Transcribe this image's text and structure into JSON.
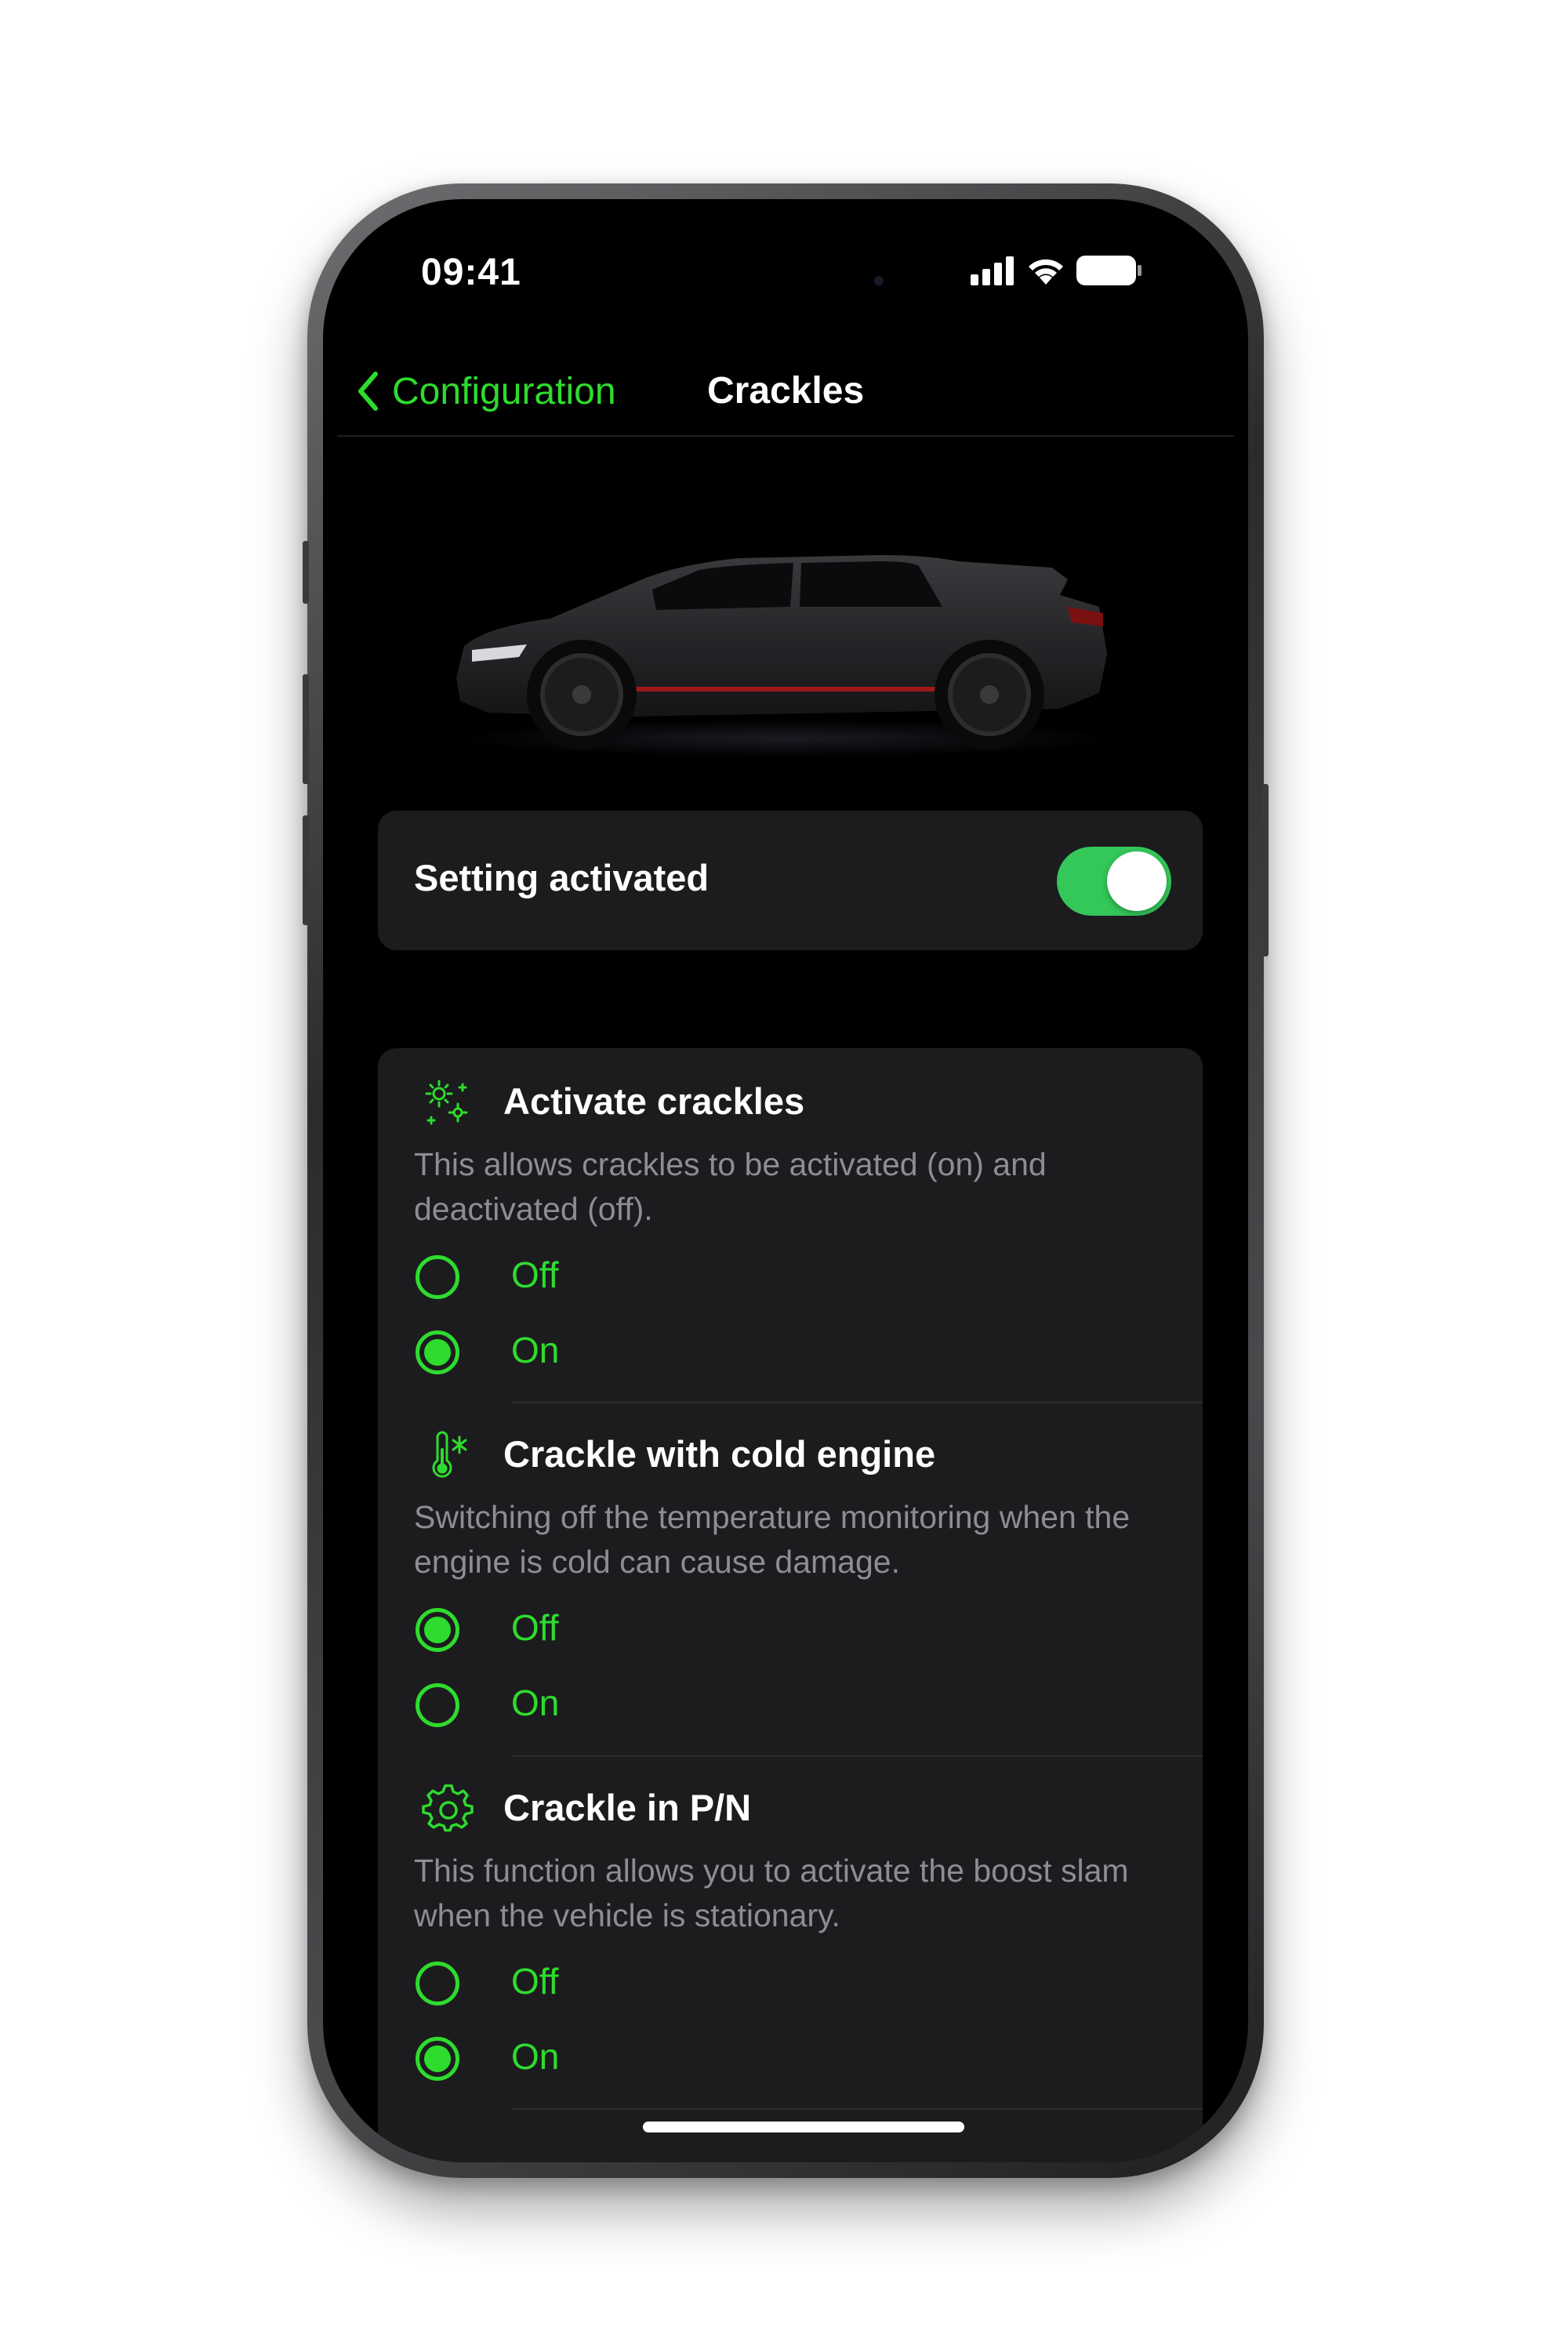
{
  "status_bar": {
    "time": "09:41"
  },
  "nav": {
    "back_label": "Configuration",
    "title": "Crackles"
  },
  "master_toggle": {
    "label": "Setting activated",
    "state": "on"
  },
  "sections": [
    {
      "title": "Activate crackles",
      "description": "This allows crackles to be activated (on) and deactivated (off).",
      "icon": "sparkle-icon",
      "options": [
        {
          "label": "Off",
          "selected": false
        },
        {
          "label": "On",
          "selected": true
        }
      ]
    },
    {
      "title": "Crackle with cold engine",
      "description": "Switching off the temperature monitoring when the engine is cold can cause damage.",
      "icon": "thermometer-snowflake-icon",
      "options": [
        {
          "label": "Off",
          "selected": true
        },
        {
          "label": "On",
          "selected": false
        }
      ]
    },
    {
      "title": "Crackle in P/N",
      "description": "This function allows you to activate the boost slam when the vehicle is stationary.",
      "icon": "gear-icon",
      "options": [
        {
          "label": "Off",
          "selected": false
        },
        {
          "label": "On",
          "selected": true
        }
      ]
    }
  ],
  "colors": {
    "accent": "#2EDC2E",
    "toggle_on": "#34C759",
    "card": "#1C1C1E",
    "background": "#000000"
  }
}
